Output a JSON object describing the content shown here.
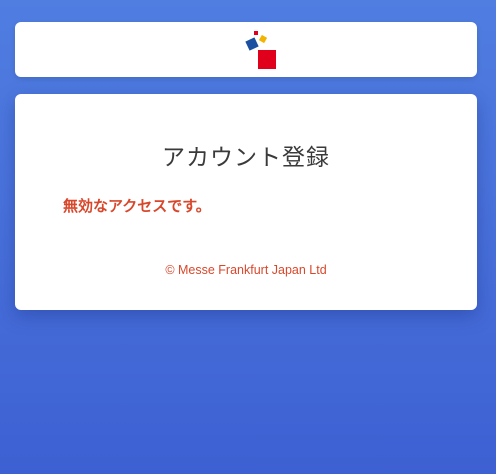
{
  "header": {
    "logo_icon": "messe-frankfurt-logo-icon",
    "colors": {
      "blue": "#1b4fa0",
      "yellow": "#f2b400",
      "red": "#e0001b"
    }
  },
  "main": {
    "title": "アカウント登録",
    "error_message": "無効なアクセスです。",
    "copyright": "© Messe Frankfurt Japan Ltd"
  },
  "theme": {
    "background": "#4a73dc",
    "accent_text": "#d9472b",
    "card": "#ffffff"
  }
}
